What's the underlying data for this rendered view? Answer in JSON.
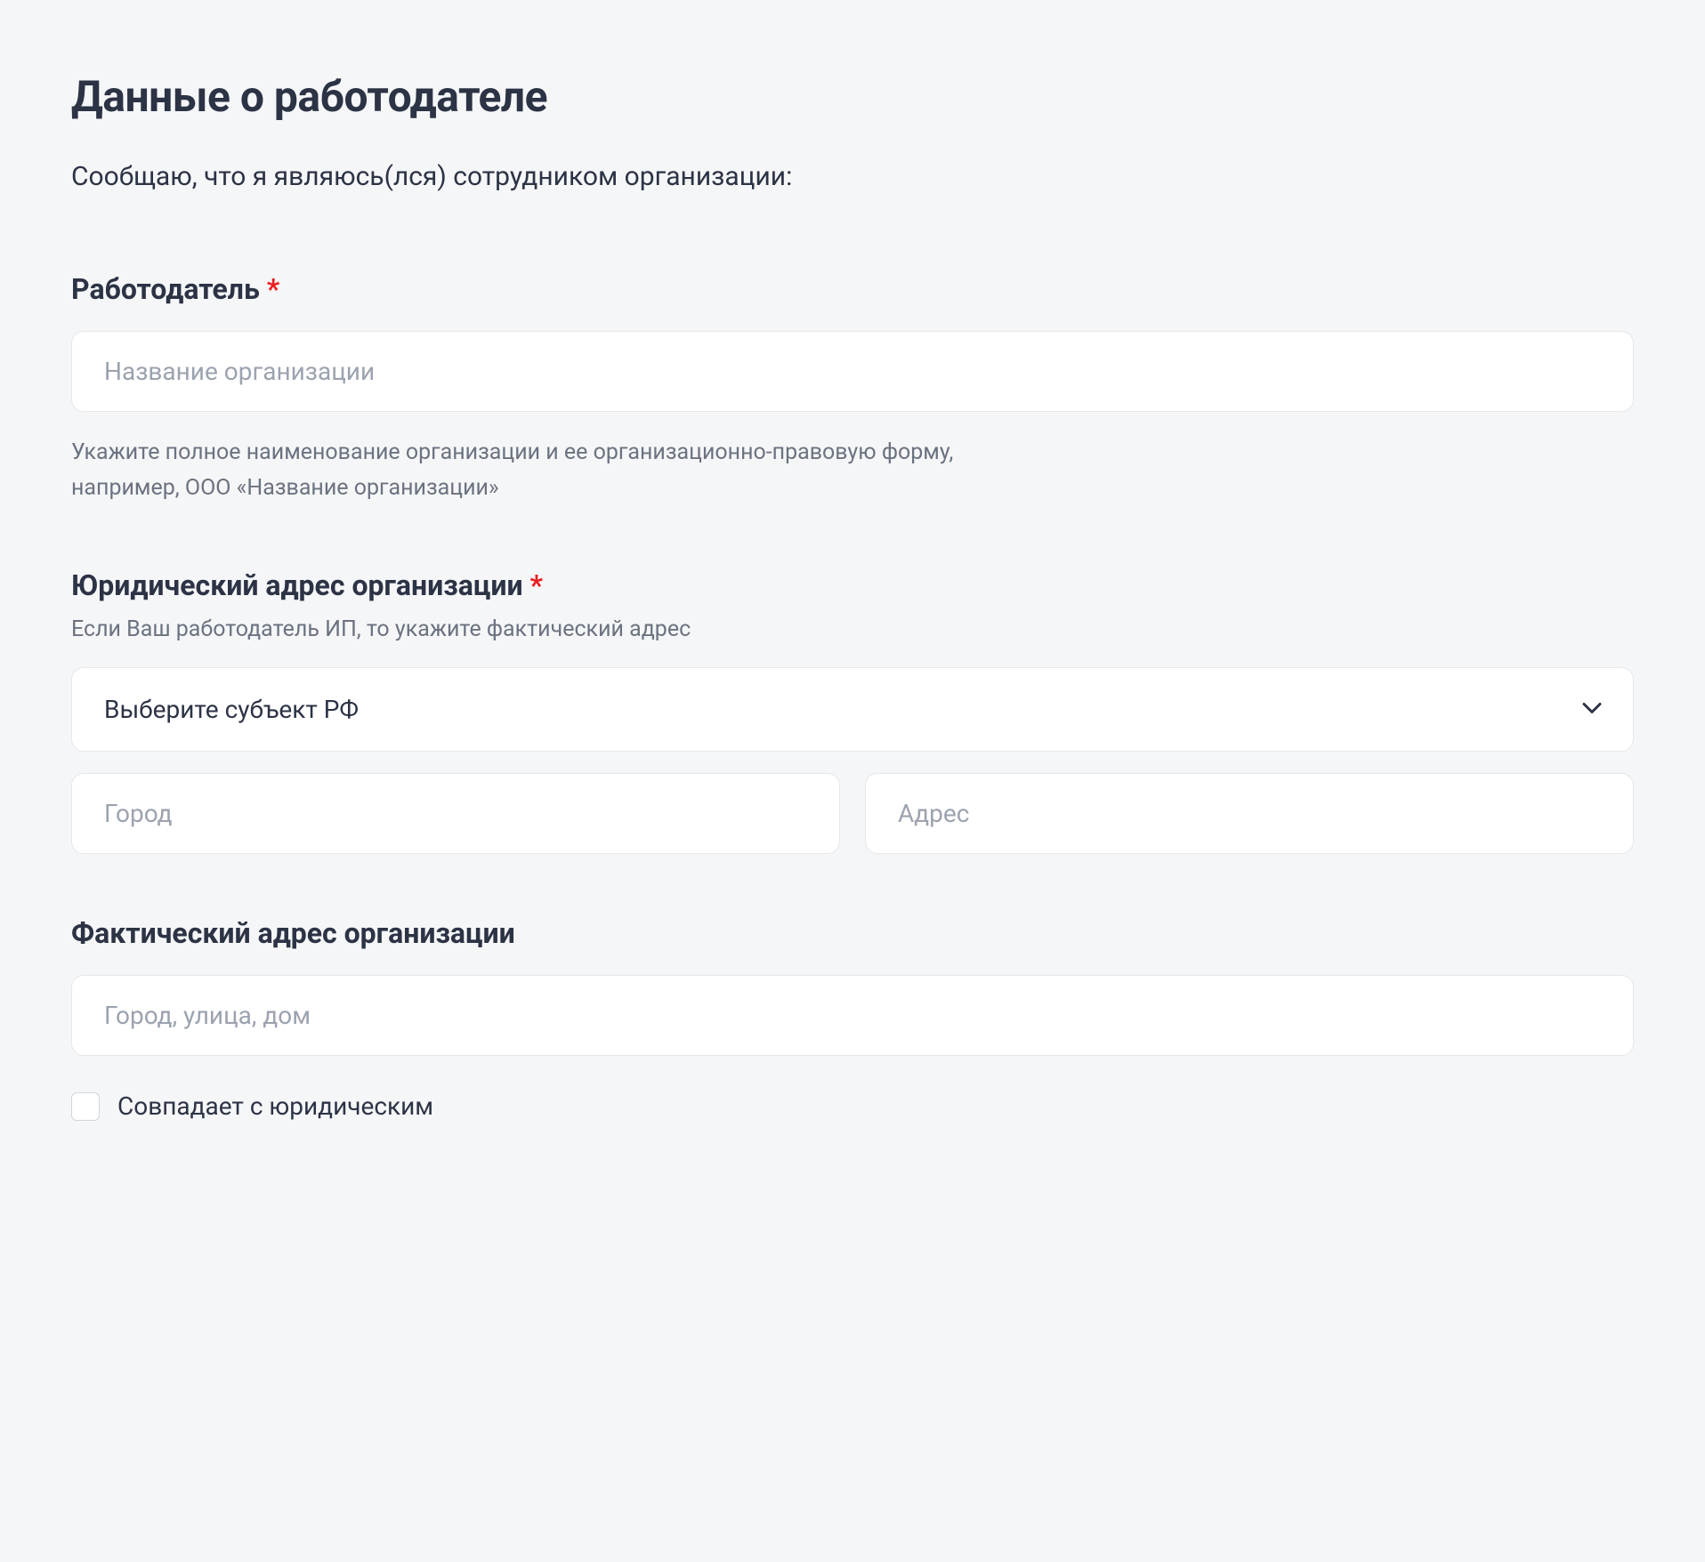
{
  "title": "Данные о работодателе",
  "intro": "Сообщаю, что я являюсь(лся) сотрудником организации:",
  "employer": {
    "label": "Работодатель",
    "required": "*",
    "placeholder": "Название организации",
    "help": "Укажите полное наименование организации и ее организационно-правовую форму, например, ООО «Название организации»"
  },
  "legal_address": {
    "label": "Юридический адрес организации",
    "required": "*",
    "sub_label": "Если Ваш работодатель ИП, то укажите фактический адрес",
    "subject_placeholder": "Выберите субъект РФ",
    "city_placeholder": "Город",
    "address_placeholder": "Адрес"
  },
  "actual_address": {
    "label": "Фактический адрес организации",
    "placeholder": "Город, улица, дом"
  },
  "checkbox": {
    "label": "Совпадает с юридическим"
  }
}
